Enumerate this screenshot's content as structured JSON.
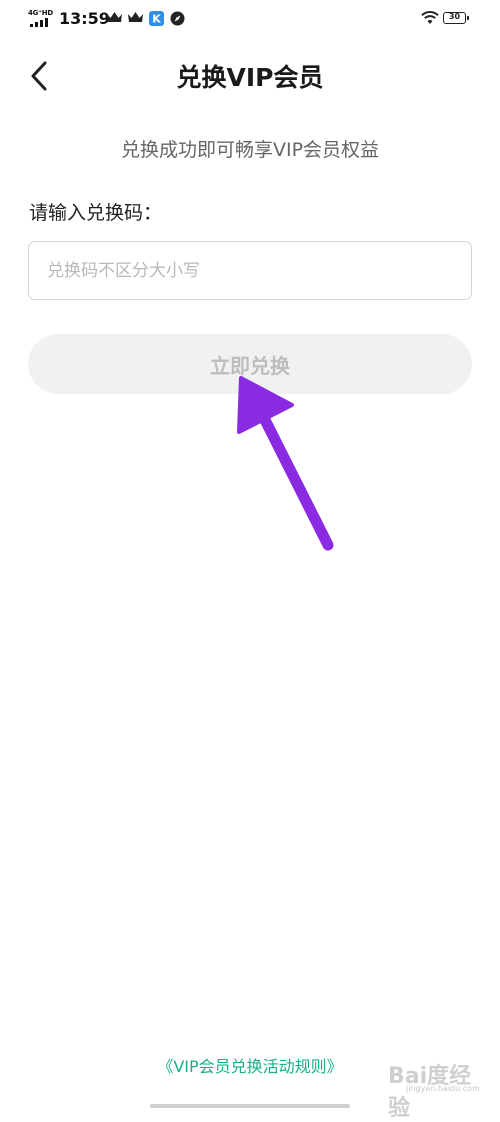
{
  "status_bar": {
    "network": "4G⁺HD",
    "time": "13:59",
    "battery": "30"
  },
  "header": {
    "title": "兑换VIP会员"
  },
  "main": {
    "subtitle": "兑换成功即可畅享VIP会员权益",
    "label": "请输入兑换码：",
    "input_placeholder": "兑换码不区分大小写",
    "input_value": "",
    "button_label": "立即兑换"
  },
  "footer": {
    "rules_link": "《VIP会员兑换活动规则》"
  },
  "watermark": {
    "text": "Bai度经验",
    "sub": "jingyan.baidu.com"
  },
  "colors": {
    "accent_green": "#17b08a",
    "annotation_arrow": "#8a2be2",
    "button_bg": "#f1f1f1",
    "button_text": "#bdbdbd"
  }
}
